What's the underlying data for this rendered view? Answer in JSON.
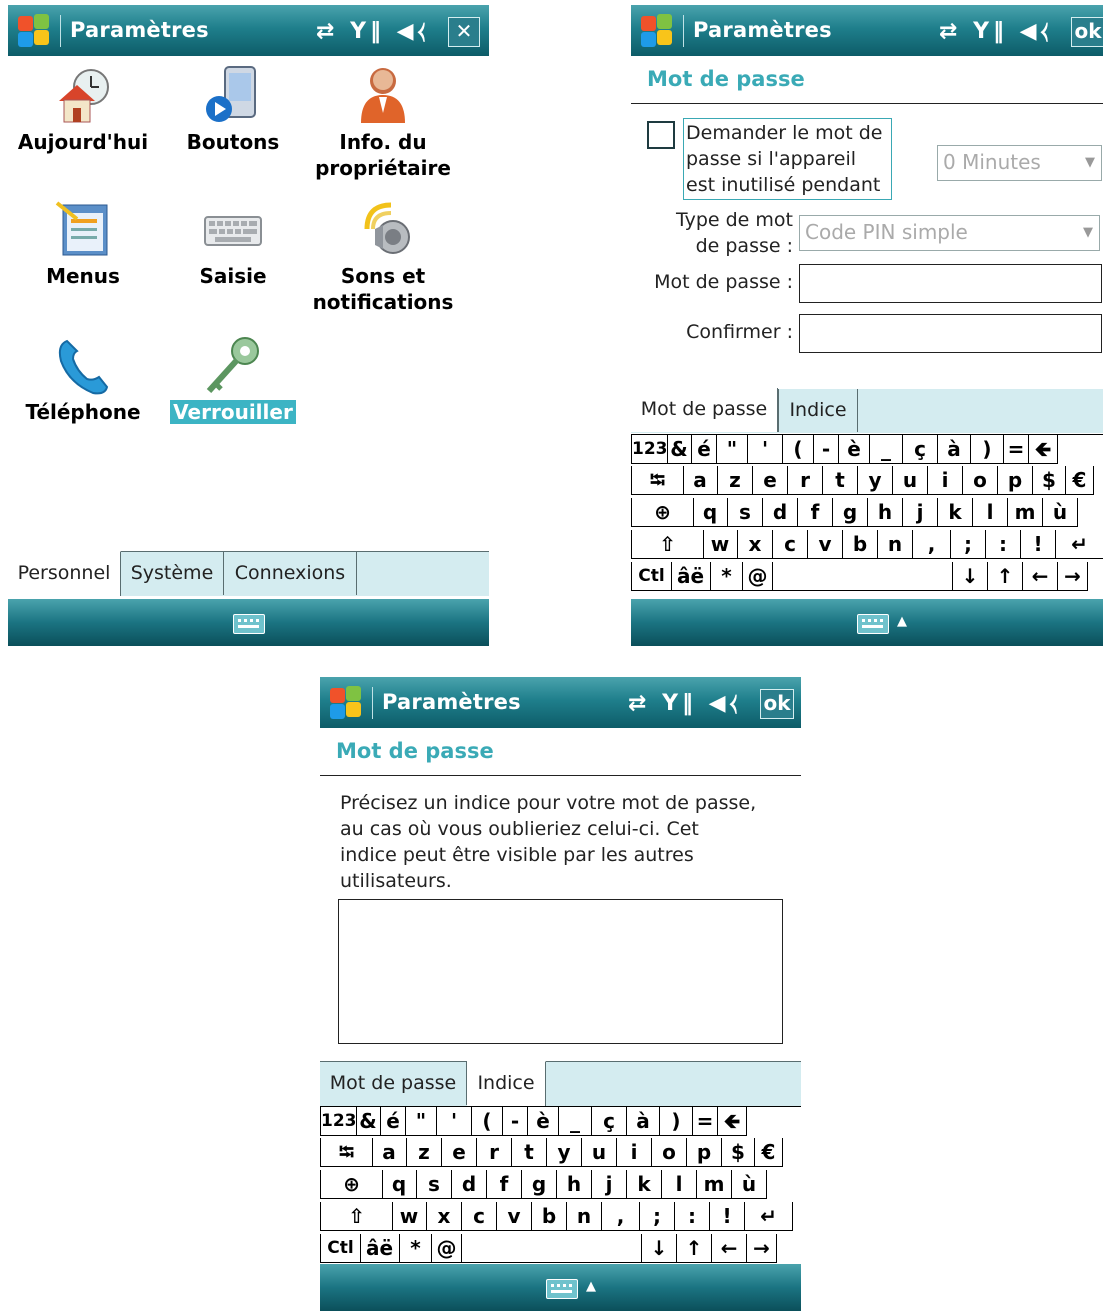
{
  "app_title": "Paramètres",
  "status_icons": "⇄ Y‖ ◀⧼",
  "screen1": {
    "close_button": "✕",
    "apps": [
      {
        "label": "Aujourd'hui",
        "icon": "today-house-clock-icon"
      },
      {
        "label": "Boutons",
        "icon": "buttons-device-icon"
      },
      {
        "label": "Info. du\npropriétaire",
        "icon": "owner-info-person-icon"
      },
      {
        "label": "Menus",
        "icon": "menus-window-icon"
      },
      {
        "label": "Saisie",
        "icon": "input-keyboard-icon"
      },
      {
        "label": "Sons et\nnotifications",
        "icon": "sounds-speaker-icon"
      },
      {
        "label": "Téléphone",
        "icon": "phone-handset-icon"
      },
      {
        "label": "Verrouiller",
        "icon": "lock-key-icon",
        "selected": true
      }
    ],
    "tabs": [
      "Personnel",
      "Système",
      "Connexions"
    ],
    "active_tab": "Personnel"
  },
  "screen2": {
    "ok_button": "ok",
    "page_title": "Mot de passe",
    "checkbox_label": "Demander le mot de passe si l'appareil est inutilisé pendant",
    "checkbox_checked": false,
    "minutes_value": "0 Minutes",
    "type_label": "Type de mot de passe :",
    "type_value": "Code PIN simple",
    "password_label": "Mot de passe :",
    "password_value": "",
    "confirm_label": "Confirmer :",
    "confirm_value": "",
    "tabs": [
      "Mot de passe",
      "Indice"
    ],
    "active_tab": "Mot de passe"
  },
  "screen3": {
    "ok_button": "ok",
    "page_title": "Mot de passe",
    "hint_text": "Précisez un indice pour votre mot de passe, au cas où vous oublieriez celui-ci. Cet indice peut être visible par les autres utilisateurs.",
    "hint_value": "",
    "tabs": [
      "Mot de passe",
      "Indice"
    ],
    "active_tab": "Indice"
  },
  "keyboard": {
    "row1": [
      "123",
      "&",
      "é",
      "\"",
      "'",
      "(",
      "-",
      "è",
      "_",
      "ç",
      "à",
      ")",
      "=",
      "🡸"
    ],
    "row2": [
      "⭾",
      "a",
      "z",
      "e",
      "r",
      "t",
      "y",
      "u",
      "i",
      "o",
      "p",
      "$",
      "€"
    ],
    "row3": [
      "⊕",
      "q",
      "s",
      "d",
      "f",
      "g",
      "h",
      "j",
      "k",
      "l",
      "m",
      "ù"
    ],
    "row4": [
      "⇧",
      "w",
      "x",
      "c",
      "v",
      "b",
      "n",
      ",",
      ";",
      ":",
      "!",
      "↵"
    ],
    "row5": [
      "Ctl",
      "âë",
      "*",
      "@",
      "",
      "↓",
      "↑",
      "←",
      "→"
    ]
  },
  "colors": {
    "titlebar": "#1f7f8c",
    "accent": "#3aaab6",
    "selection": "#3cb4c4",
    "tabbar": "#d4ecf0"
  }
}
